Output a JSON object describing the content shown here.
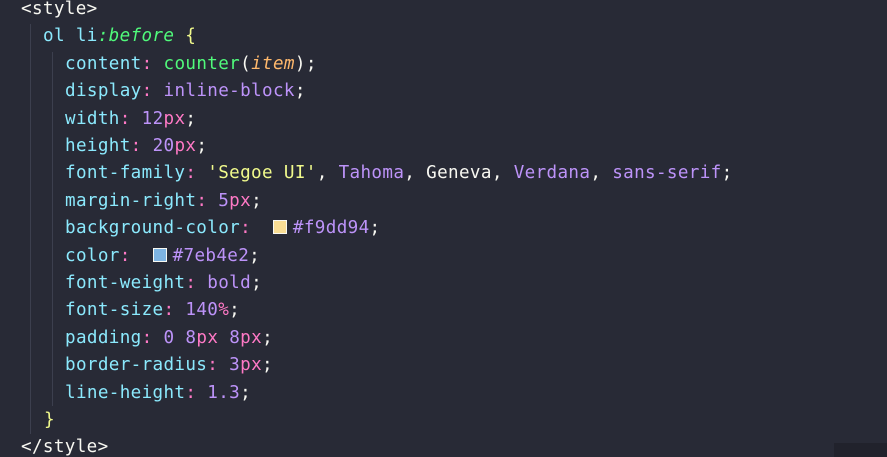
{
  "code": {
    "open_tag": "<style>",
    "close_tag": "</style>",
    "selector": "ol li",
    "pseudo": ":before",
    "open_brace": "{",
    "close_brace": "}",
    "content": {
      "prop": "content",
      "fn": "counter",
      "open_paren": "(",
      "arg": "item",
      "close_paren": ")"
    },
    "display": {
      "prop": "display",
      "value": "inline-block"
    },
    "width": {
      "prop": "width",
      "num": "12",
      "unit": "px"
    },
    "height": {
      "prop": "height",
      "num": "20",
      "unit": "px"
    },
    "font_family": {
      "prop": "font-family",
      "v1": "'Segoe UI'",
      "v2": "Tahoma",
      "v3": "Geneva",
      "v4": "Verdana",
      "v5": "sans-serif"
    },
    "margin_right": {
      "prop": "margin-right",
      "num": "5",
      "unit": "px"
    },
    "background_color": {
      "prop": "background-color",
      "value": "#f9dd94",
      "swatch": "#f9dd94"
    },
    "color": {
      "prop": "color",
      "value": "#7eb4e2",
      "swatch": "#7eb4e2"
    },
    "font_weight": {
      "prop": "font-weight",
      "value": "bold"
    },
    "font_size": {
      "prop": "font-size",
      "num": "140",
      "unit": "%"
    },
    "padding": {
      "prop": "padding",
      "n1": "0",
      "n2": "8",
      "u2": "px",
      "n3": "8",
      "u3": "px"
    },
    "border_radius": {
      "prop": "border-radius",
      "num": "3",
      "unit": "px"
    },
    "line_height": {
      "prop": "line-height",
      "num": "1.3"
    }
  }
}
